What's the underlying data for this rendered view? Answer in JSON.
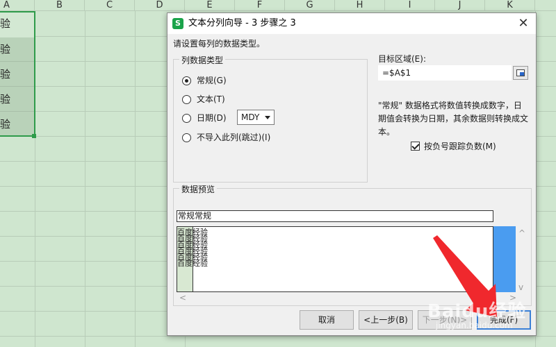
{
  "sheet": {
    "columns": [
      "A",
      "B",
      "C",
      "D",
      "E",
      "F",
      "G",
      "H",
      "I",
      "J",
      "K"
    ],
    "cells_a": [
      "验",
      "验",
      "验",
      "验",
      "验"
    ]
  },
  "dialog": {
    "title": "文本分列向导 - 3 步骤之 3",
    "app_icon_letter": "S",
    "close_symbol": "✕",
    "prompt": "请设置每列的数据类型。",
    "column_type_group": {
      "title": "列数据类型",
      "options": [
        {
          "label": "常规(G)",
          "selected": true
        },
        {
          "label": "文本(T)",
          "selected": false
        },
        {
          "label": "日期(D)",
          "selected": false
        },
        {
          "label": "不导入此列(跳过)(I)",
          "selected": false
        }
      ],
      "date_format": "MDY"
    },
    "target": {
      "label": "目标区域(E):",
      "value": "=$A$1"
    },
    "description": "\"常规\" 数据格式将数值转换成数字，日期值会转换为日期，其余数据则转换成文本。",
    "negative_checkbox": {
      "label": "按负号跟踪负数(M)",
      "checked": true
    },
    "preview": {
      "title": "数据预览",
      "header": "常规常规",
      "rows": [
        "百度经验",
        "百度经验",
        "百度经验",
        "百度经验",
        "百度经验",
        "百度经验"
      ],
      "scroll_up": "^",
      "scroll_down": "v",
      "scroll_left": "<",
      "scroll_right": ">"
    },
    "buttons": {
      "cancel": "取消",
      "back": "<上一步(B)",
      "next": "下一步(N)>",
      "finish": "完成(F)"
    }
  },
  "watermark": {
    "brand": "Baidu经验",
    "sub": "jingyan.baidu.com"
  },
  "colors": {
    "sheet_bg": "#cfe6cf",
    "selection_border": "#2e9b4a",
    "default_button_border": "#3a7fd6",
    "scroll_fill": "#4a9cf0",
    "arrow": "#f0282d"
  }
}
